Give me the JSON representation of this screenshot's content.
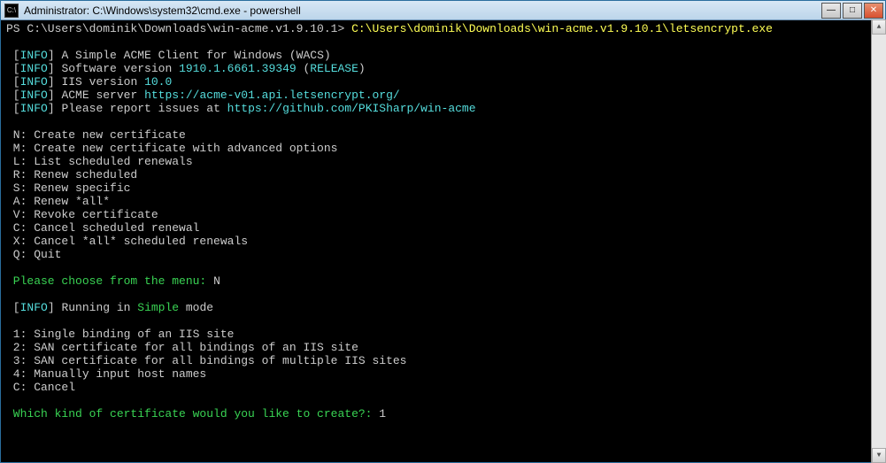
{
  "titlebar": {
    "text": "Administrator: C:\\Windows\\system32\\cmd.exe - powershell"
  },
  "prompt": {
    "ps": "PS ",
    "path": "C:\\Users\\dominik\\Downloads\\win-acme.v1.9.10.1",
    "gt": "> ",
    "cmd": "C:\\Users\\dominik\\Downloads\\win-acme.v1.9.10.1\\letsencrypt.exe"
  },
  "info": {
    "open": " [",
    "tag": "INFO",
    "close": "] ",
    "l1": "A Simple ACME Client for Windows (WACS)",
    "l2a": "Software version ",
    "l2b": "1910.1.6661.39349",
    "l2c": " (",
    "l2d": "RELEASE",
    "l2e": ")",
    "l3a": "IIS version ",
    "l3b": "10.0",
    "l4a": "ACME server ",
    "l4b": "https://acme-v01.api.letsencrypt.org/",
    "l5a": "Please report issues at ",
    "l5b": "https://github.com/PKISharp/win-acme"
  },
  "menu": {
    "n": " N: Create new certificate",
    "m": " M: Create new certificate with advanced options",
    "l": " L: List scheduled renewals",
    "r": " R: Renew scheduled",
    "s": " S: Renew specific",
    "a": " A: Renew *all*",
    "v": " V: Revoke certificate",
    "c": " C: Cancel scheduled renewal",
    "x": " X: Cancel *all* scheduled renewals",
    "q": " Q: Quit"
  },
  "choose": {
    "prompt": " Please choose from the menu:",
    "sp": " ",
    "ans": "N"
  },
  "running": {
    "a": "Running in ",
    "b": "Simple",
    "c": " mode"
  },
  "sub": {
    "o1": " 1: Single binding of an IIS site",
    "o2": " 2: SAN certificate for all bindings of an IIS site",
    "o3": " 3: SAN certificate for all bindings of multiple IIS sites",
    "o4": " 4: Manually input host names",
    "oc": " C: Cancel"
  },
  "which": {
    "prompt": " Which kind of certificate would you like to create?:",
    "sp": " ",
    "ans": "1"
  }
}
